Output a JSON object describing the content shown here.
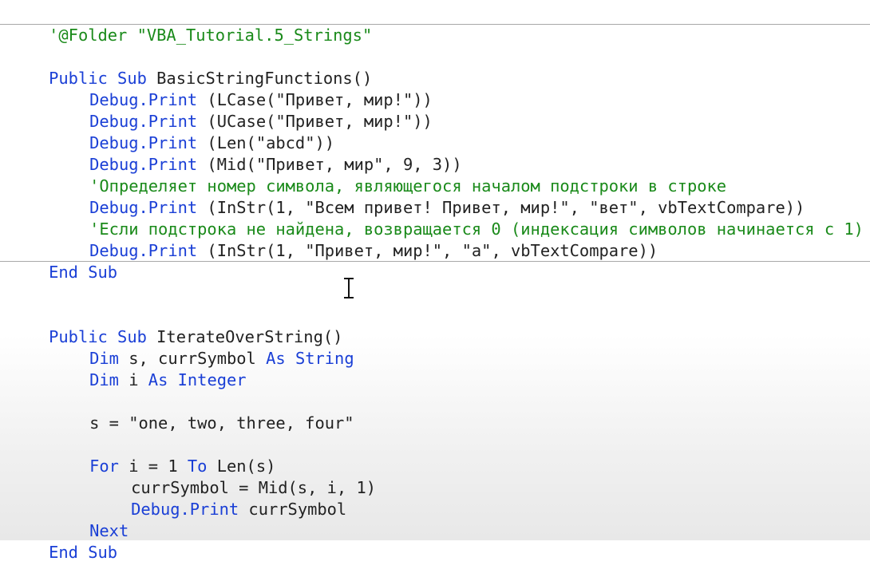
{
  "code_pane": {
    "folder_line": "'@Folder \"VBA_Tutorial.5_Strings\"",
    "sub1": {
      "header": [
        "Public Sub",
        " BasicStringFunctions()"
      ],
      "line1": [
        "Debug.Print",
        " (LCase(\"Привет, мир!\"))"
      ],
      "line2": [
        "Debug.Print",
        " (UCase(\"Привет, мир!\"))"
      ],
      "line3": [
        "Debug.Print",
        " (Len(\"abcd\"))"
      ],
      "line4": [
        "Debug.Print",
        " (Mid(\"Привет, мир\", 9, 3))"
      ],
      "comment1": "'Определяет номер символа, являющегося началом подстроки в строке",
      "line5": [
        "Debug.Print",
        " (InStr(1, \"Всем привет! Привет, мир!\", \"вет\", vbTextCompare))"
      ],
      "comment2": "'Если подстрока не найдена, возвращается 0 (индексация символов начинается с 1)",
      "line6": [
        "Debug.Print",
        " (InStr(1, \"Привет, мир!\", \"а\", vbTextCompare))"
      ],
      "footer": "End Sub"
    },
    "sub2": {
      "header": [
        "Public Sub",
        " IterateOverString()"
      ],
      "dim1": [
        "Dim",
        " s, currSymbol ",
        "As String"
      ],
      "dim2": [
        "Dim",
        " i ",
        "As Integer"
      ],
      "assign": "s = \"one, two, three, four\"",
      "for_line": [
        "For",
        " i = 1 ",
        "To",
        " Len(s)"
      ],
      "body1": "currSymbol = Mid(s, i, 1)",
      "body2": [
        "Debug.Print",
        " currSymbol"
      ],
      "next": "Next",
      "footer": "End Sub"
    }
  },
  "colors": {
    "keyword": "#1a3fd6",
    "comment": "#1a8a1a",
    "text": "#222222",
    "divider": "#a8a8a8"
  },
  "cursor": "i-beam-cursor"
}
